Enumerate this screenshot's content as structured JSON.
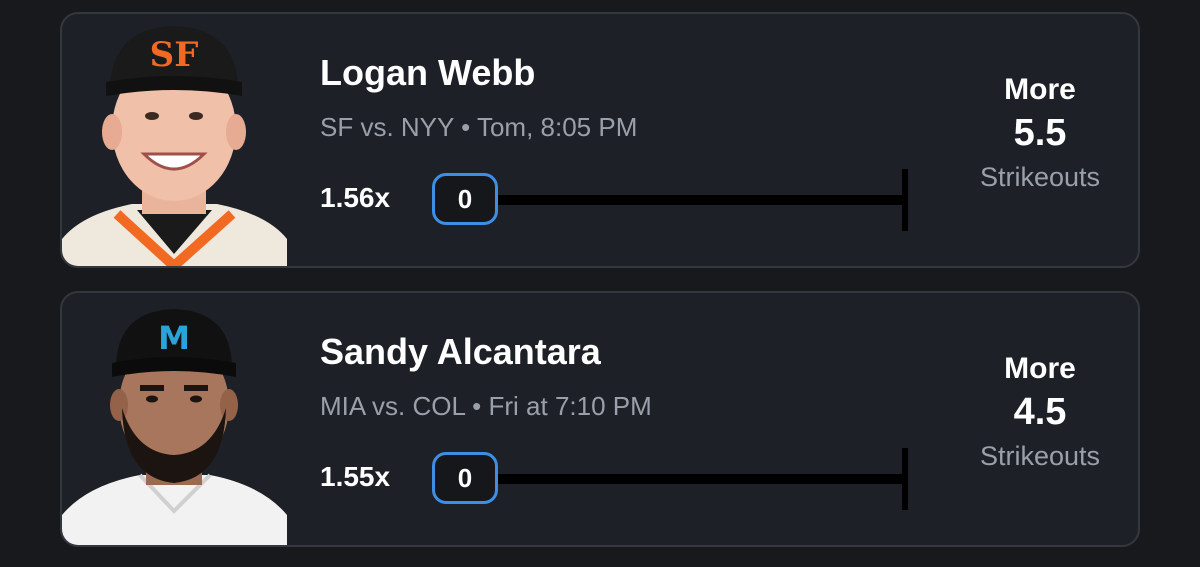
{
  "cards": [
    {
      "player_name": "Logan Webb",
      "matchup": "SF vs. NYY • Tom, 8:05 PM",
      "multiplier": "1.56x",
      "progress_value": "0",
      "progress_fraction": 0,
      "pick_direction": "More",
      "pick_line": "5.5",
      "pick_stat": "Strikeouts",
      "cap_logo": "SF",
      "cap_color": "#1a1a1a",
      "logo_color": "#f26a21",
      "jersey_color": "#efe8dc",
      "trim_color": "#f26a21"
    },
    {
      "player_name": "Sandy Alcantara",
      "matchup": "MIA vs. COL • Fri at 7:10 PM",
      "multiplier": "1.55x",
      "progress_value": "0",
      "progress_fraction": 0,
      "pick_direction": "More",
      "pick_line": "4.5",
      "pick_stat": "Strikeouts",
      "cap_logo": "M",
      "cap_color": "#111111",
      "logo_color": "#2aa3d8",
      "jersey_color": "#f2f2f2",
      "trim_color": "#d0d0d0"
    }
  ],
  "colors": {
    "background": "#17191d",
    "card_background": "#1d2026",
    "card_border": "#33373e",
    "accent": "#3d8fe6",
    "muted_text": "#9aa0a9"
  },
  "icons": [
    "player-headshot-photo",
    "team-cap-logo"
  ]
}
